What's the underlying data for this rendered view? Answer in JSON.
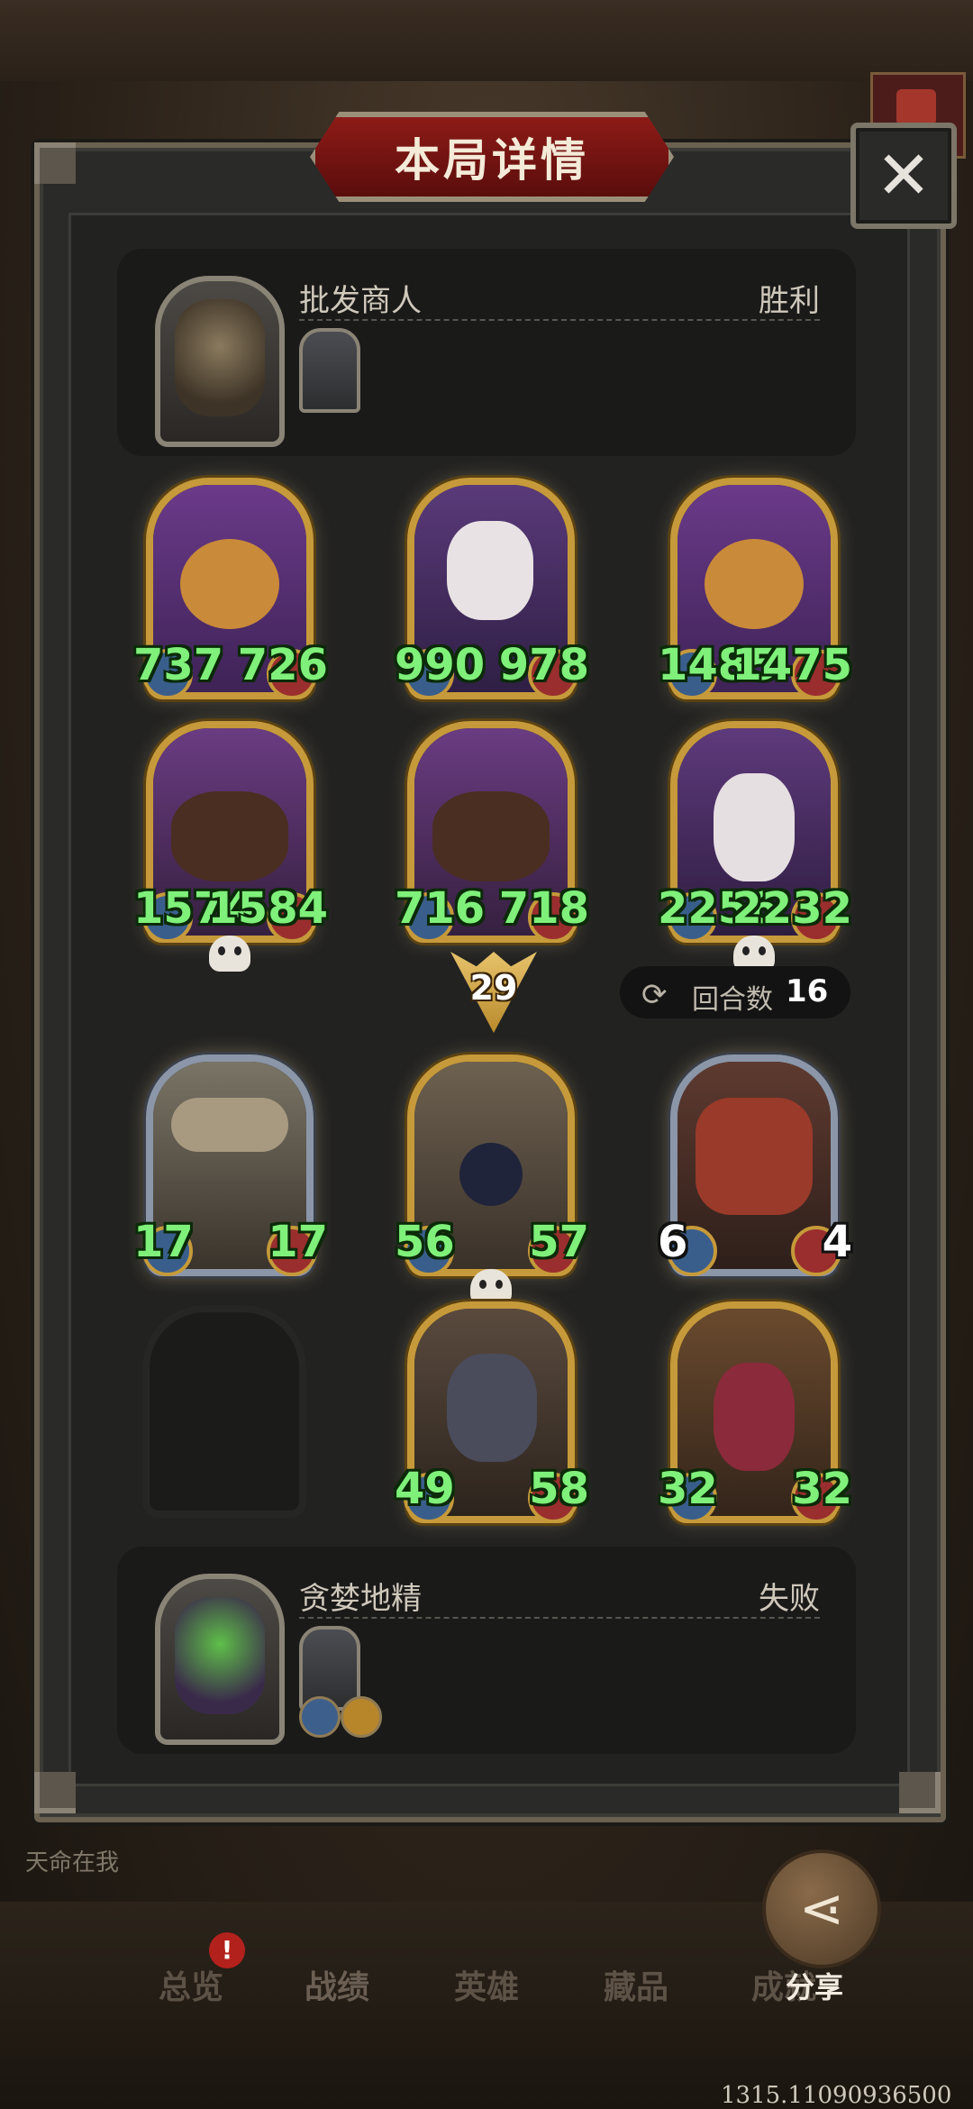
{
  "title": "本局详情",
  "close_icon": "close-icon",
  "top_player": {
    "name": "批发商人",
    "result": "胜利"
  },
  "bottom_player": {
    "name": "贪婪地精",
    "result": "失败"
  },
  "opponent_cards_row1": [
    {
      "attack": "737",
      "health": "726"
    },
    {
      "attack": "990",
      "health": "978"
    },
    {
      "attack": "1485",
      "health": "1475"
    }
  ],
  "opponent_cards_row2": [
    {
      "attack": "1574",
      "health": "1584"
    },
    {
      "attack": "716",
      "health": "718"
    },
    {
      "attack": "2256",
      "health": "2232"
    }
  ],
  "turn_damage": "29",
  "rounds": {
    "label": "回合数",
    "value": "16"
  },
  "my_cards_row1": [
    {
      "attack": "17",
      "health": "17"
    },
    {
      "attack": "56",
      "health": "57"
    },
    {
      "attack": "6",
      "health": "4"
    }
  ],
  "my_cards_row2": [
    {
      "attack": "49",
      "health": "58"
    },
    {
      "attack": "32",
      "health": "32"
    }
  ],
  "chat_text": "天命在我",
  "nav": {
    "overview": "总览",
    "record": "战绩",
    "heroes": "英雄",
    "collection": "藏品",
    "achievement": "成就",
    "notification_badge": "!"
  },
  "share_label": "分享",
  "footer_id": "1315.110909365​00"
}
